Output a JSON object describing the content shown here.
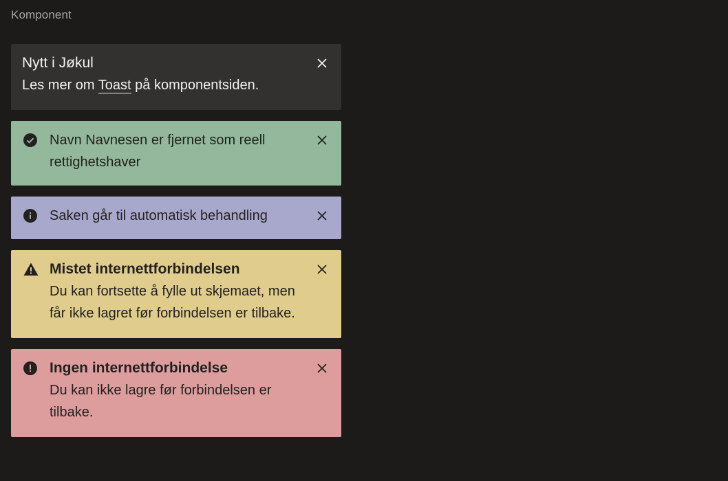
{
  "page": {
    "label": "Komponent"
  },
  "toasts": {
    "news": {
      "title": "Nytt i Jøkul",
      "body_before": "Les mer om ",
      "link": "Toast",
      "body_after": " på komponentsiden.",
      "background": "#323130"
    },
    "success": {
      "icon": "check-circle-icon",
      "message": "Navn Navnesen er fjernet som reell rettighetshaver",
      "background": "#93b89b"
    },
    "info": {
      "icon": "info-circle-icon",
      "message": "Saken går til automatisk behandling",
      "background": "#a7a8cc"
    },
    "warning": {
      "icon": "warning-triangle-icon",
      "title": "Mistet internettforbindelsen",
      "message": "Du kan fortsette å fylle ut skjemaet, men får ikke lagret før forbindelsen er tilbake.",
      "background": "#e0cd8d"
    },
    "error": {
      "icon": "error-circle-icon",
      "title": "Ingen internettforbindelse",
      "message": "Du kan ikke lagre før forbindelsen er tilbake.",
      "background": "#de9d9d"
    }
  }
}
